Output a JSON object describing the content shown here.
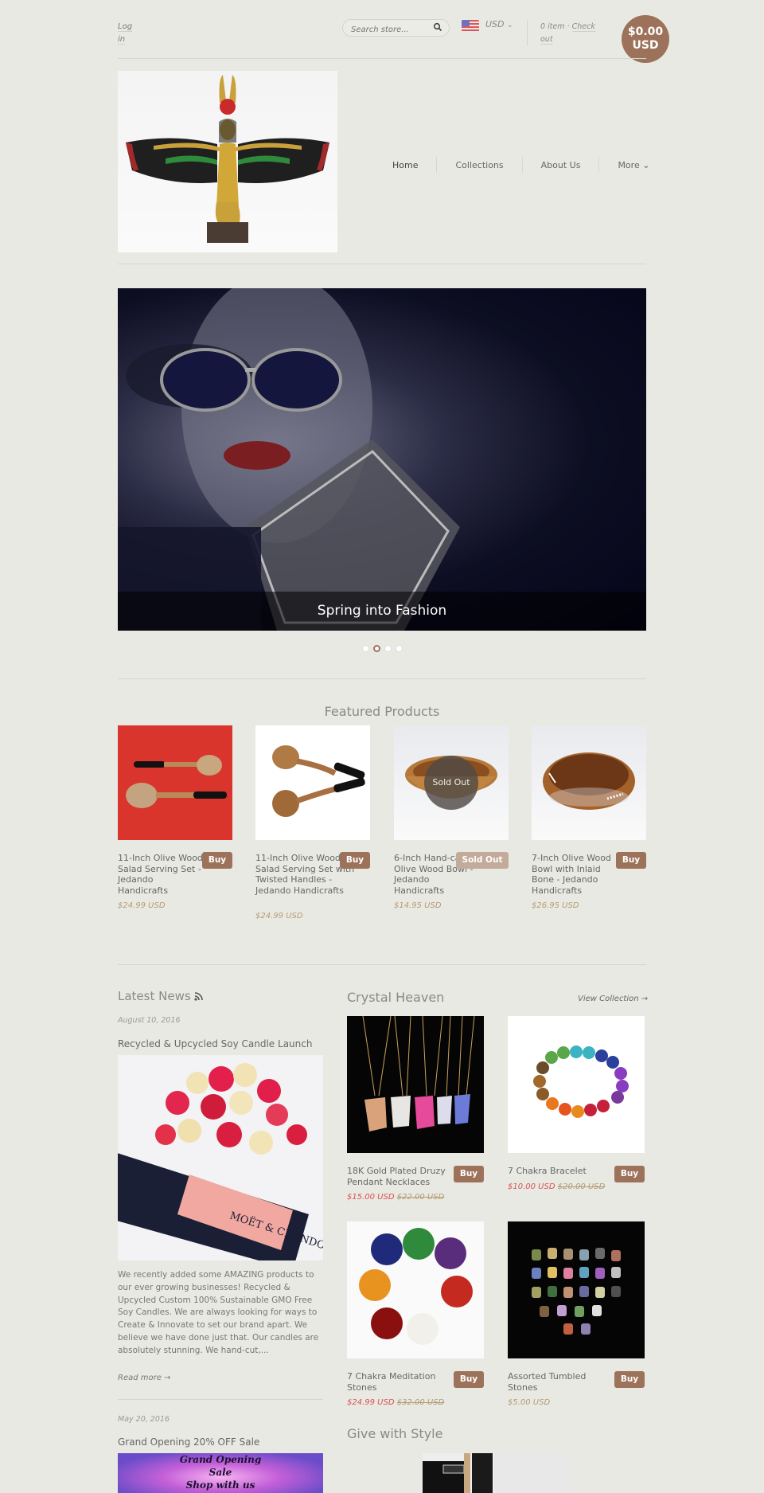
{
  "header": {
    "login_line1": "Log",
    "login_line2": "in",
    "search_placeholder": "Search store...",
    "currency": "USD",
    "cart_count": "0 item",
    "cart_sep": "·",
    "checkout_line1": "Check",
    "checkout_line2": "out",
    "cart_total_line1": "$0.00",
    "cart_total_line2": "USD"
  },
  "nav": {
    "items": [
      {
        "label": "Home"
      },
      {
        "label": "Collections"
      },
      {
        "label": "About Us"
      },
      {
        "label": "More ⌄"
      }
    ]
  },
  "hero": {
    "caption": "Spring into Fashion",
    "slide_count": 4,
    "active_slide": 2
  },
  "featured": {
    "title": "Featured Products",
    "products": [
      {
        "title": "11-Inch Olive Wood Salad Serving Set - Jedando Handicrafts",
        "price": "$24.99 USD",
        "button": "Buy",
        "sold_out": false
      },
      {
        "title": "11-Inch Olive Wood Salad Serving Set with Twisted Handles - Jedando Handicrafts",
        "price": "$24.99 USD",
        "button": "Buy",
        "sold_out": false
      },
      {
        "title": "6-Inch Hand-carved Olive Wood Bowl - Jedando Handicrafts",
        "price": "$14.95 USD",
        "button": "Sold Out",
        "sold_out": true,
        "overlay": "Sold Out"
      },
      {
        "title": "7-Inch Olive Wood Bowl with Inlaid Bone - Jedando Handicrafts",
        "price": "$26.95 USD",
        "button": "Buy",
        "sold_out": false
      }
    ]
  },
  "news": {
    "title": "Latest News",
    "articles": [
      {
        "date": "August 10, 2016",
        "title": "Recycled & Upcycled Soy Candle Launch",
        "excerpt": "We recently added some AMAZING products to our ever growing businesses! Recycled & Upcycled Custom 100% Sustainable GMO Free Soy Candles. We are always looking for ways to Create & Innovate to set our brand apart. We believe we have done just that. Our candles are absolutely stunning. We hand-cut,...",
        "read_more": "Read more →",
        "image_text": "MOËT & CHANDON"
      },
      {
        "date": "May 20, 2016",
        "title": "Grand Opening 20% OFF Sale",
        "image_text_1": "Grand Opening",
        "image_text_2": "Sale",
        "image_text_3": "Shop with us"
      }
    ]
  },
  "crystal": {
    "title": "Crystal Heaven",
    "view_collection": "View Collection →",
    "products": [
      {
        "title": "18K Gold Plated Druzy Pendant Necklaces",
        "sale_price": "$15.00 USD",
        "old_price": "$22.00 USD",
        "button": "Buy"
      },
      {
        "title": "7 Chakra Bracelet",
        "sale_price": "$10.00 USD",
        "old_price": "$20.00 USD",
        "button": "Buy"
      },
      {
        "title": "7 Chakra Meditation Stones",
        "sale_price": "$24.99 USD",
        "old_price": "$32.00 USD",
        "button": "Buy"
      },
      {
        "title": "Assorted Tumbled Stones",
        "price": "$5.00 USD",
        "button": "Buy"
      }
    ]
  },
  "give": {
    "title": "Give with Style"
  }
}
